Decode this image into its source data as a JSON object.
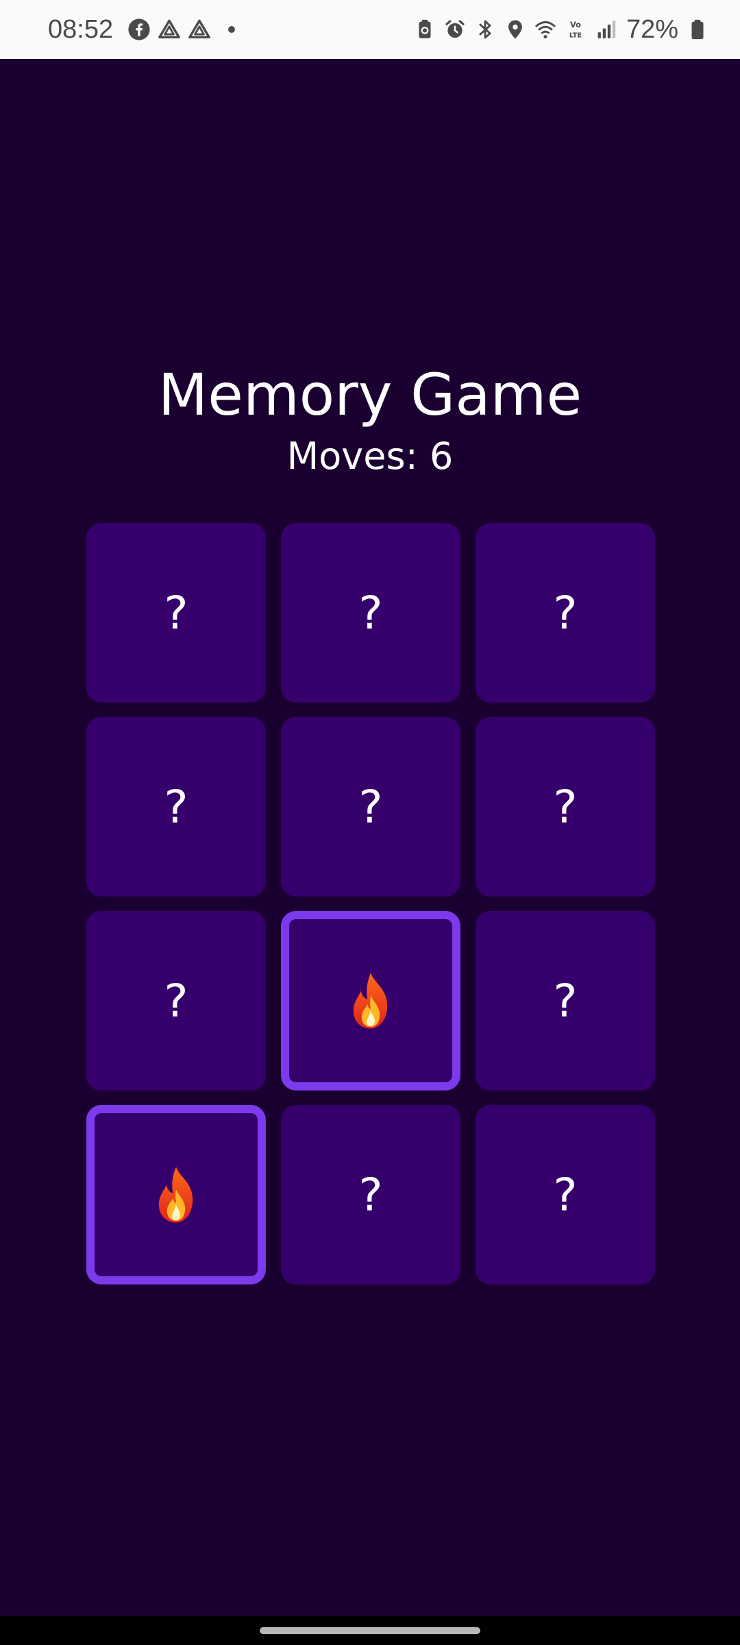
{
  "status_bar": {
    "time": "08:52",
    "left_icons": [
      "facebook-icon",
      "drive-icon",
      "drive-icon"
    ],
    "right_icons": [
      "battery-saver-icon",
      "alarm-icon",
      "bluetooth-icon",
      "location-icon",
      "wifi-icon",
      "volte-icon",
      "signal-icon"
    ],
    "battery_percent": "72%"
  },
  "game": {
    "title": "Memory Game",
    "moves_text": "Moves: 6",
    "hidden_symbol": "?",
    "cards": [
      {
        "state": "hidden",
        "label": "?"
      },
      {
        "state": "hidden",
        "label": "?"
      },
      {
        "state": "hidden",
        "label": "?"
      },
      {
        "state": "hidden",
        "label": "?"
      },
      {
        "state": "hidden",
        "label": "?"
      },
      {
        "state": "hidden",
        "label": "?"
      },
      {
        "state": "hidden",
        "label": "?"
      },
      {
        "state": "flipped",
        "icon": "fire-icon"
      },
      {
        "state": "hidden",
        "label": "?"
      },
      {
        "state": "flipped",
        "icon": "fire-icon"
      },
      {
        "state": "hidden",
        "label": "?"
      },
      {
        "state": "hidden",
        "label": "?"
      }
    ]
  },
  "colors": {
    "background": "#1a0030",
    "card": "#36006c",
    "card_highlight_border": "#7c3aed",
    "text": "#ffffff"
  }
}
